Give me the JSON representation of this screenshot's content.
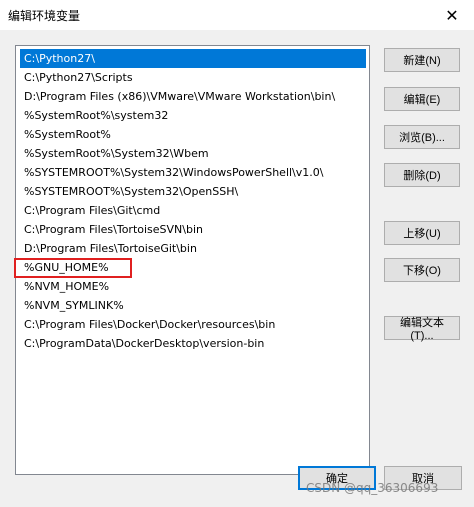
{
  "window": {
    "title": "编辑环境变量",
    "close_glyph": "✕"
  },
  "paths": [
    "C:\\Python27\\",
    "C:\\Python27\\Scripts",
    "D:\\Program Files (x86)\\VMware\\VMware Workstation\\bin\\",
    "%SystemRoot%\\system32",
    "%SystemRoot%",
    "%SystemRoot%\\System32\\Wbem",
    "%SYSTEMROOT%\\System32\\WindowsPowerShell\\v1.0\\",
    "%SYSTEMROOT%\\System32\\OpenSSH\\",
    "C:\\Program Files\\Git\\cmd",
    "C:\\Program Files\\TortoiseSVN\\bin",
    "D:\\Program Files\\TortoiseGit\\bin",
    "%GNU_HOME%",
    "%NVM_HOME%",
    "%NVM_SYMLINK%",
    "C:\\Program Files\\Docker\\Docker\\resources\\bin",
    "C:\\ProgramData\\DockerDesktop\\version-bin"
  ],
  "selected_index": 0,
  "highlighted_index": 11,
  "buttons": {
    "new": "新建(N)",
    "edit": "编辑(E)",
    "browse": "浏览(B)...",
    "delete": "删除(D)",
    "move_up": "上移(U)",
    "move_down": "下移(O)",
    "edit_text": "编辑文本(T)...",
    "ok": "确定",
    "cancel": "取消"
  },
  "watermark": "CSDN @qq_36306693",
  "colors": {
    "selection": "#0078d7",
    "highlight_border": "#e02020",
    "dialog_bg": "#f0f0f0"
  }
}
